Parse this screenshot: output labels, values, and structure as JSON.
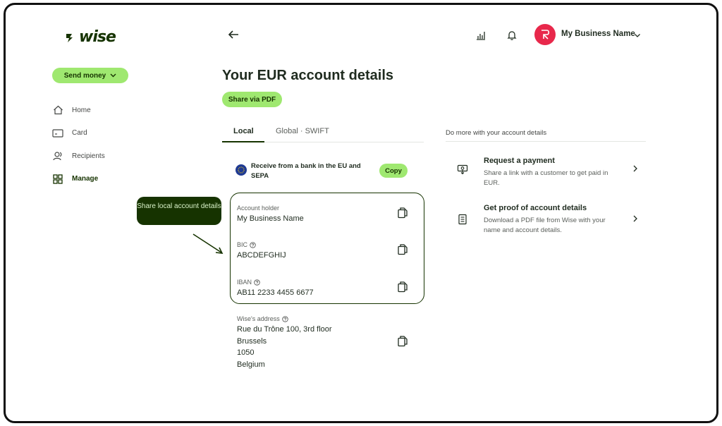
{
  "brand": {
    "logo_text": "wise",
    "accent": "#9fe870",
    "dark": "#163300",
    "avatar_color": "#e8284b"
  },
  "sidebar": {
    "send_money_label": "Send money",
    "items": [
      {
        "label": "Home",
        "icon": "home-icon"
      },
      {
        "label": "Card",
        "icon": "card-icon"
      },
      {
        "label": "Recipients",
        "icon": "recipients-icon"
      },
      {
        "label": "Manage",
        "icon": "grid-icon",
        "active": true
      }
    ]
  },
  "callout": {
    "text": "Share local account details"
  },
  "header": {
    "business_name": "My Business Name"
  },
  "main": {
    "title": "Your EUR account details",
    "share_pdf_label": "Share via PDF",
    "tabs": [
      {
        "label": "Local",
        "active": true
      },
      {
        "label": "Global · SWIFT"
      }
    ],
    "receive_text": "Receive from a bank in the EU and SEPA",
    "copy_label": "Copy",
    "fields": [
      {
        "label": "Account holder",
        "value": "My Business Name",
        "help": false
      },
      {
        "label": "BIC",
        "value": "ABCDEFGHIJ",
        "help": true
      },
      {
        "label": "IBAN",
        "value": "AB11 2233 4455 6677",
        "help": true
      }
    ],
    "address": {
      "label": "Wise's address",
      "lines": [
        "Rue du Trône 100, 3rd floor",
        "Brussels",
        "1050",
        "Belgium"
      ]
    }
  },
  "right_panel": {
    "title": "Do more with your account details",
    "actions": [
      {
        "title": "Request a payment",
        "desc": "Share a link with a customer to get paid in EUR.",
        "icon": "payment-request-icon"
      },
      {
        "title": "Get proof of account details",
        "desc": "Download a PDF file from Wise with your name and account details.",
        "icon": "document-icon"
      }
    ]
  }
}
